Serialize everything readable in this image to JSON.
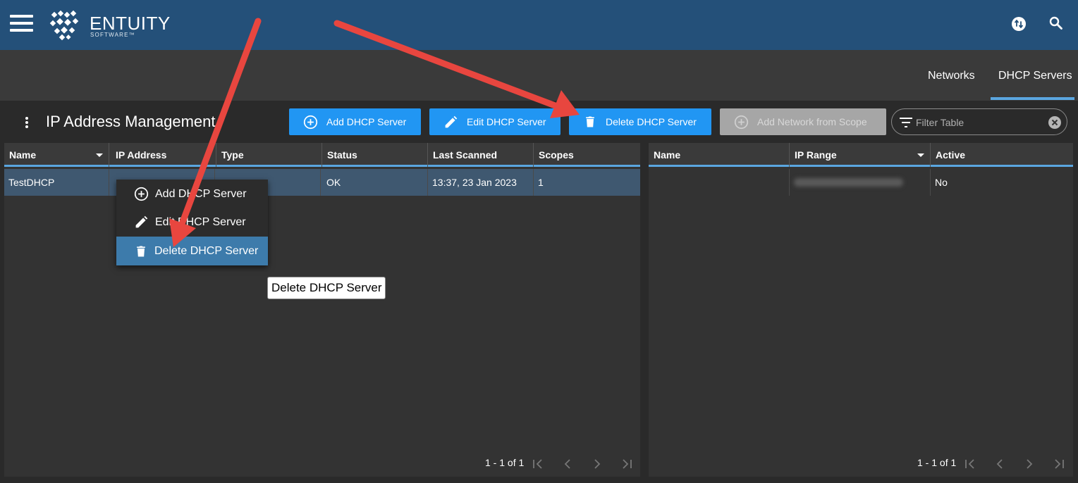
{
  "app": {
    "logo_text": "ENTUITY",
    "logo_sub": "SOFTWARE™"
  },
  "tabs": [
    {
      "label": "Networks",
      "active": false
    },
    {
      "label": "DHCP Servers",
      "active": true
    }
  ],
  "page": {
    "title": "IP Address Management"
  },
  "toolbar": {
    "add_label": "Add DHCP Server",
    "edit_label": "Edit DHCP Server",
    "delete_label": "Delete DHCP Server",
    "add_network_label": "Add Network from Scope"
  },
  "filter": {
    "placeholder": "Filter Table",
    "value": ""
  },
  "servers_table": {
    "columns": [
      "Name",
      "IP Address",
      "Type",
      "Status",
      "Last Scanned",
      "Scopes"
    ],
    "rows": [
      {
        "name": "TestDHCP",
        "status": "OK",
        "last_scanned": "13:37, 23 Jan 2023",
        "scopes": "1"
      }
    ],
    "pager": "1 - 1 of 1"
  },
  "scopes_table": {
    "columns": [
      "Name",
      "IP Range",
      "Active"
    ],
    "rows": [
      {
        "active": "No"
      }
    ],
    "pager": "1 - 1 of 1"
  },
  "context_menu": {
    "items": [
      {
        "label": "Add DHCP Server"
      },
      {
        "label": "Edit DHCP Server"
      },
      {
        "label": "Delete DHCP Server",
        "highlighted": true
      }
    ]
  },
  "tooltip": {
    "text": "Delete DHCP Server"
  },
  "colors": {
    "appbar": "#245079",
    "accent": "#2196f3",
    "tab_underline": "#5aa6e0",
    "annotation_arrow": "#e8463f"
  },
  "icons": [
    "menu-icon",
    "switch-icon",
    "search-icon",
    "more-vert-icon",
    "add-circle-icon",
    "pencil-icon",
    "trash-icon",
    "filter-icon",
    "clear-icon",
    "first-page-icon",
    "prev-page-icon",
    "next-page-icon",
    "last-page-icon"
  ]
}
